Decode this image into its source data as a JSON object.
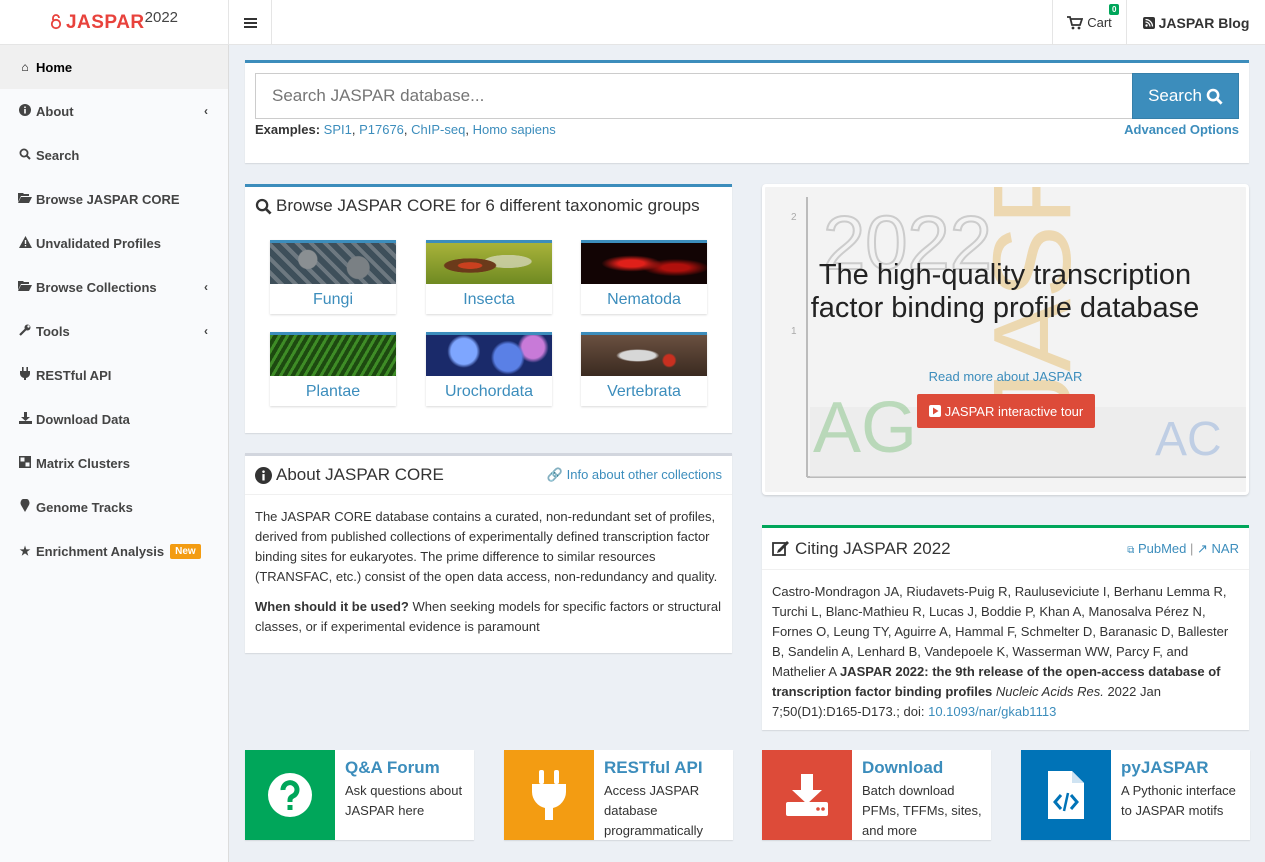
{
  "header": {
    "brand": "JASPAR",
    "year": "2022",
    "cart_label": "Cart",
    "cart_count": "0",
    "blog_label": "JASPAR Blog"
  },
  "sidebar": {
    "items": [
      {
        "label": "Home",
        "icon": "home-icon"
      },
      {
        "label": "About",
        "icon": "info-icon"
      },
      {
        "label": "Search",
        "icon": "search-icon"
      },
      {
        "label": "Browse JASPAR CORE",
        "icon": "folder-open-icon"
      },
      {
        "label": "Unvalidated Profiles",
        "icon": "warning-icon"
      },
      {
        "label": "Browse Collections",
        "icon": "folder-open-icon"
      },
      {
        "label": "Tools",
        "icon": "wrench-icon"
      },
      {
        "label": "RESTful API",
        "icon": "plug-icon"
      },
      {
        "label": "Download Data",
        "icon": "download-icon"
      },
      {
        "label": "Matrix Clusters",
        "icon": "cubes-icon"
      },
      {
        "label": "Genome Tracks",
        "icon": "map-marker-icon"
      },
      {
        "label": "Enrichment Analysis",
        "icon": "star-icon",
        "badge": "New"
      }
    ]
  },
  "search": {
    "placeholder": "Search JASPAR database...",
    "button_label": "Search",
    "examples_label": "Examples:",
    "examples": [
      "SPI1",
      "P17676",
      "ChIP-seq",
      "Homo sapiens"
    ],
    "advanced_label": "Advanced Options"
  },
  "taxonomy": {
    "title": "Browse JASPAR CORE for 6 different taxonomic groups",
    "groups": [
      "Fungi",
      "Insecta",
      "Nematoda",
      "Plantae",
      "Urochordata",
      "Vertebrata"
    ]
  },
  "about": {
    "title": "About JASPAR CORE",
    "info_link": "Info about other collections",
    "paragraph": "The JASPAR CORE database contains a curated, non-redundant set of profiles, derived from published collections of experimentally defined transcription factor binding sites for eukaryotes. The prime difference to similar resources (TRANSFAC, etc.) consist of the open data access, non-redundancy and quality.",
    "question": "When should it be used?",
    "answer": "When seeking models for specific factors or structural classes, or if experimental evidence is paramount"
  },
  "hero": {
    "title": "The high-quality transcription factor binding profile database",
    "link": "Read more about JASPAR",
    "tour_button": "JASPAR interactive tour",
    "bg_year": "2022",
    "bg_word": "JASPAR"
  },
  "citing": {
    "title": "Citing JASPAR 2022",
    "pubmed": "PubMed",
    "separator": "|",
    "nar": "NAR",
    "authors": "Castro-Mondragon JA, Riudavets-Puig R, Rauluseviciute I, Berhanu Lemma R, Turchi L, Blanc-Mathieu R, Lucas J, Boddie P, Khan A, Manosalva Pérez N, Fornes O, Leung TY, Aguirre A, Hammal F, Schmelter D, Baranasic D, Ballester B, Sandelin A, Lenhard B, Vandepoele K, Wasserman WW, Parcy F, and Mathelier A",
    "paper_title": "JASPAR 2022: the 9th release of the open-access database of transcription factor binding profiles",
    "journal": "Nucleic Acids Res.",
    "details": "2022 Jan 7;50(D1):D165-D173.; doi:",
    "doi": "10.1093/nar/gkab1113"
  },
  "tiles": [
    {
      "title": "Q&A Forum",
      "desc": "Ask questions about JASPAR here",
      "color": "#00a65a",
      "icon": "question-icon"
    },
    {
      "title": "RESTful API",
      "desc": "Access JASPAR database programmatically",
      "color": "#f39c12",
      "icon": "plug-icon"
    },
    {
      "title": "Download",
      "desc": "Batch download PFMs, TFFMs, sites, and more",
      "color": "#dd4b39",
      "icon": "download-icon"
    },
    {
      "title": "pyJASPAR",
      "desc": "A Pythonic interface to JASPAR motifs",
      "color": "#0073b7",
      "icon": "file-code-icon"
    }
  ],
  "colors": {
    "primary": "#3c8dbc",
    "brand_red": "#e8423c",
    "green": "#00a65a",
    "orange": "#f39c12",
    "red": "#dd4b39",
    "blue": "#0073b7"
  }
}
